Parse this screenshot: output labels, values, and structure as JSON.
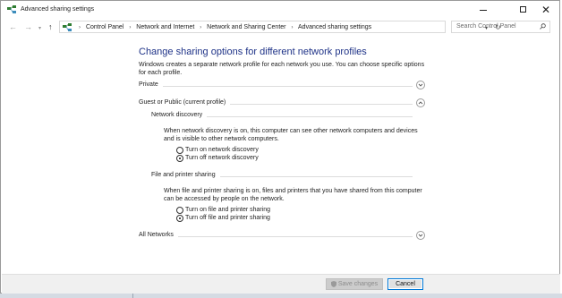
{
  "window": {
    "title": "Advanced sharing settings",
    "controls": {
      "minimize": "minimize",
      "maximize": "maximize",
      "close": "✕"
    }
  },
  "addressbar": {
    "breadcrumbs": [
      "Control Panel",
      "Network and Internet",
      "Network and Sharing Center",
      "Advanced sharing settings"
    ],
    "separator": "›",
    "search_placeholder": "Search Control Panel"
  },
  "main": {
    "heading": "Change sharing options for different network profiles",
    "intro": "Windows creates a separate network profile for each network you use. You can choose specific options for each profile.",
    "profiles": {
      "private": {
        "label": "Private",
        "expanded": false
      },
      "guest_public": {
        "label": "Guest or Public (current profile)",
        "expanded": true,
        "network_discovery": {
          "title": "Network discovery",
          "description": "When network discovery is on, this computer can see other network computers and devices and is visible to other network computers.",
          "options": [
            "Turn on network discovery",
            "Turn off network discovery"
          ],
          "selected_index": 1
        },
        "file_printer_sharing": {
          "title": "File and printer sharing",
          "description": "When file and printer sharing is on, files and printers that you have shared from this computer can be accessed by people on the network.",
          "options": [
            "Turn on file and printer sharing",
            "Turn off file and printer sharing"
          ],
          "selected_index": 1
        }
      },
      "all_networks": {
        "label": "All Networks",
        "expanded": false
      }
    }
  },
  "footer": {
    "save_label": "Save changes",
    "save_enabled": false,
    "cancel_label": "Cancel"
  },
  "colors": {
    "heading": "#1e3287",
    "focus_border": "#0078d7",
    "footer_bg": "#f0f0f0"
  }
}
